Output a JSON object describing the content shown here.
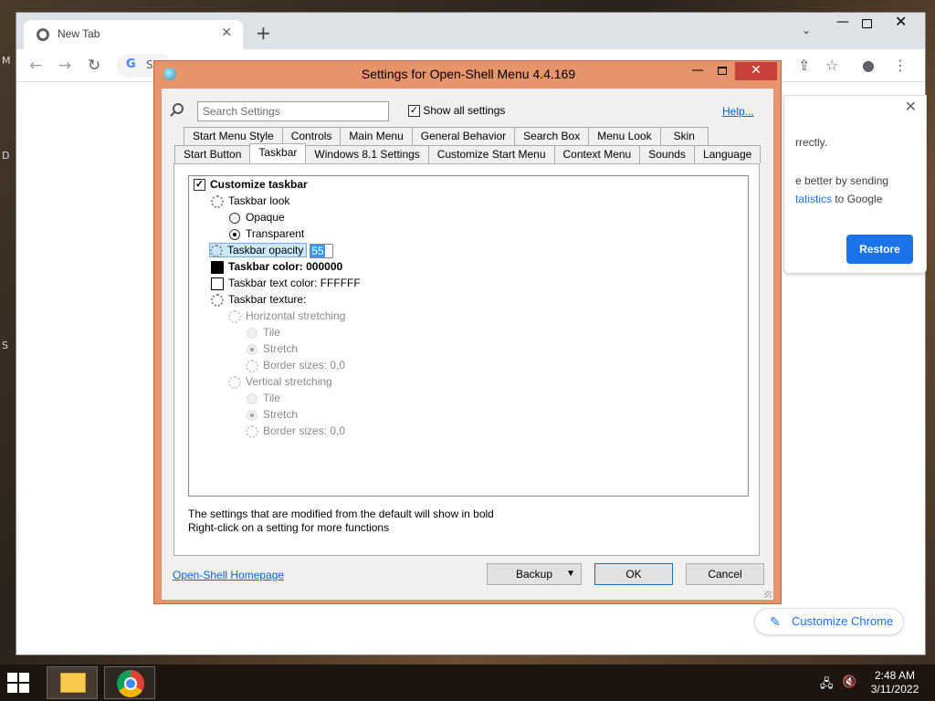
{
  "desktop": {
    "glyphs": [
      "M",
      "D",
      "S"
    ]
  },
  "chrome": {
    "tab_title": "New Tab",
    "tab_close": "✕",
    "new_tab": "+",
    "tab_search": "⌄",
    "omnibox_letter": "G",
    "omnibox_partial": "S",
    "back": "←",
    "forward": "→",
    "reload": "↻",
    "share": "⇪",
    "bookmark": "☆",
    "profile": "●",
    "menu": "⋮",
    "restore_card": {
      "line1": "rrectly.",
      "line2": "e better by sending",
      "line3_link": "tatistics",
      "line3_rest": " to Google",
      "close": "✕",
      "restore_label": "Restore"
    },
    "customize_label": "Customize Chrome"
  },
  "dialog": {
    "title": "Settings for Open-Shell Menu 4.4.169",
    "search_placeholder": "Search Settings",
    "show_all_label": "Show all settings",
    "show_all_checked": true,
    "help_label": "Help...",
    "tabs_row1": [
      "Start Menu Style",
      "Controls",
      "Main Menu",
      "General Behavior",
      "Search Box",
      "Menu Look",
      "Skin"
    ],
    "tabs_row2": [
      "Start Button",
      "Taskbar",
      "Windows 8.1 Settings",
      "Customize Start Menu",
      "Context Menu",
      "Sounds",
      "Language"
    ],
    "active_tab": "Taskbar",
    "tree": {
      "customize_taskbar": "Customize taskbar",
      "taskbar_look": "Taskbar look",
      "opaque": "Opaque",
      "transparent": "Transparent",
      "taskbar_opacity": "Taskbar opacity",
      "opacity_value": "55",
      "taskbar_color": "Taskbar color: 000000",
      "taskbar_color_hex": "#000000",
      "taskbar_text_color": "Taskbar text color: FFFFFF",
      "taskbar_text_color_hex": "#FFFFFF",
      "taskbar_texture": "Taskbar texture:",
      "horizontal_stretching": "Horizontal stretching",
      "h_tile": "Tile",
      "h_stretch": "Stretch",
      "h_border": "Border sizes: 0,0",
      "vertical_stretching": "Vertical stretching",
      "v_tile": "Tile",
      "v_stretch": "Stretch",
      "v_border": "Border sizes: 0,0"
    },
    "hint1": "The settings that are modified from the default will show in bold",
    "hint2": "Right-click on a setting for more functions",
    "homepage_label": "Open-Shell Homepage",
    "backup_label": "Backup",
    "ok_label": "OK",
    "cancel_label": "Cancel"
  },
  "taskbar": {
    "time": "2:48 AM",
    "date": "3/11/2022"
  },
  "colors": {
    "dialog_frame": "#e8946a",
    "close_button": "#c7403a",
    "link": "#0066cc",
    "chrome_accent": "#1a73e8"
  }
}
